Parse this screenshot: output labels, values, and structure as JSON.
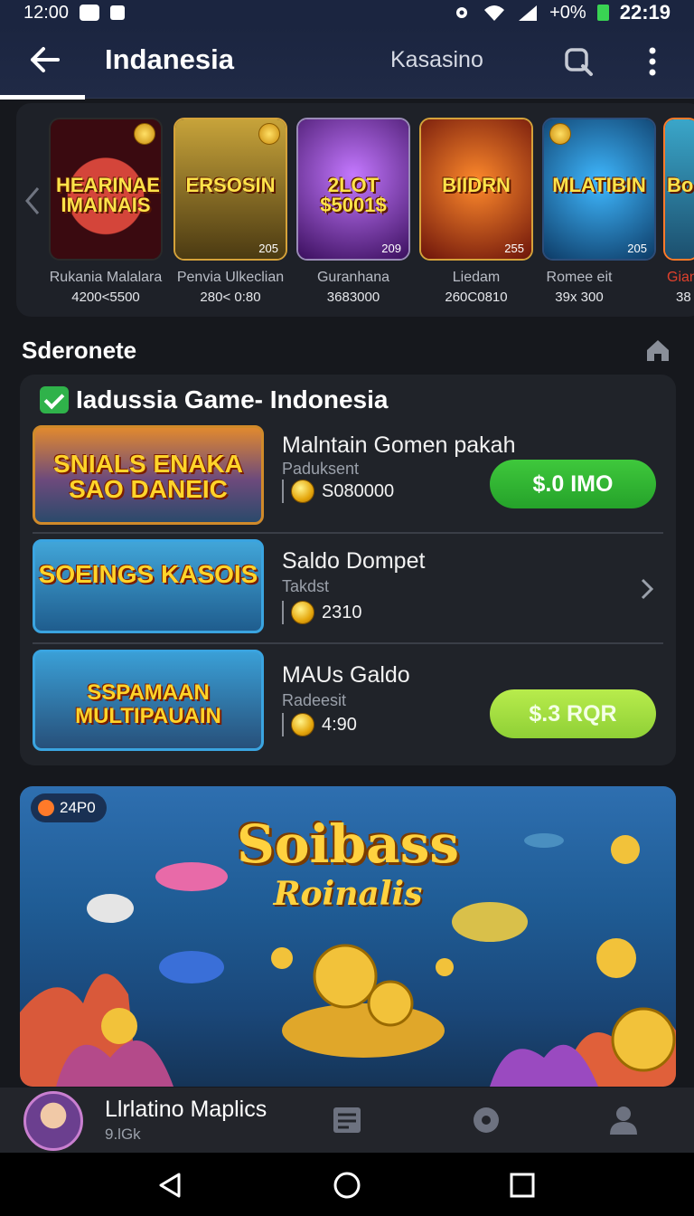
{
  "status_bar": {
    "time": "12:00",
    "battery_pct": "+0%",
    "clock_right": "22:19"
  },
  "app_bar": {
    "title": "Indanesia",
    "secondary_tab": "Kasasino"
  },
  "carousel": {
    "games": [
      {
        "art_title": "HEARINAEL IMAINAIS",
        "count": "",
        "name": "Rukania Malalara",
        "range": "4200<5500",
        "bg": "#4a0d12"
      },
      {
        "art_title": "ERSOSIN",
        "count": "205",
        "name": "Penvia Ulkeclian",
        "range": "280< 0:80",
        "bg": "#6f5b1d"
      },
      {
        "art_title": "2LOT $5001$",
        "count": "209",
        "name": "Guranhana",
        "range": "3683000",
        "bg": "#5a1d7a"
      },
      {
        "art_title": "BIIDRN",
        "count": "255",
        "name": "Liedam",
        "range": "260C0810",
        "bg": "#7a1f12"
      },
      {
        "art_title": "MLATIBIN",
        "count": "205",
        "name": "Romee eit",
        "range": "39x 300",
        "bg": "#1b5c3a"
      },
      {
        "art_title": "Bo",
        "count": "",
        "name": "Gian",
        "range": "38",
        "bg": "#27627a"
      }
    ]
  },
  "section": {
    "title": "Sderonete"
  },
  "list": {
    "header": "Iadussia Game- Indonesia",
    "rows": [
      {
        "art_title": "SNIALS ENAKA SAO DANEIC",
        "title": "Malntain Gomen pakah",
        "sub": "Paduksent",
        "amount": "S080000",
        "action": "$.0 IMO"
      },
      {
        "art_title": "SOEINGS KASOIS",
        "title": "Saldo Dompet",
        "sub": "Takdst",
        "amount": "2310",
        "action": ""
      },
      {
        "art_title": "SSPAMAAN MULTIPAUAIN",
        "title": "MAUs Galdo",
        "sub": "Radeesit",
        "amount": "4:90",
        "action": "$.3 RQR"
      }
    ]
  },
  "promo": {
    "badge": "24P0",
    "title": "Soibass",
    "subtitle": "Roinalis"
  },
  "bottom_bar": {
    "user_name": "Llrlatino Maplics",
    "user_sub": "9.lGk"
  },
  "colors": {
    "accent_green": "#2fb24a",
    "lime": "#a6e040",
    "gold": "#ffd23f"
  }
}
